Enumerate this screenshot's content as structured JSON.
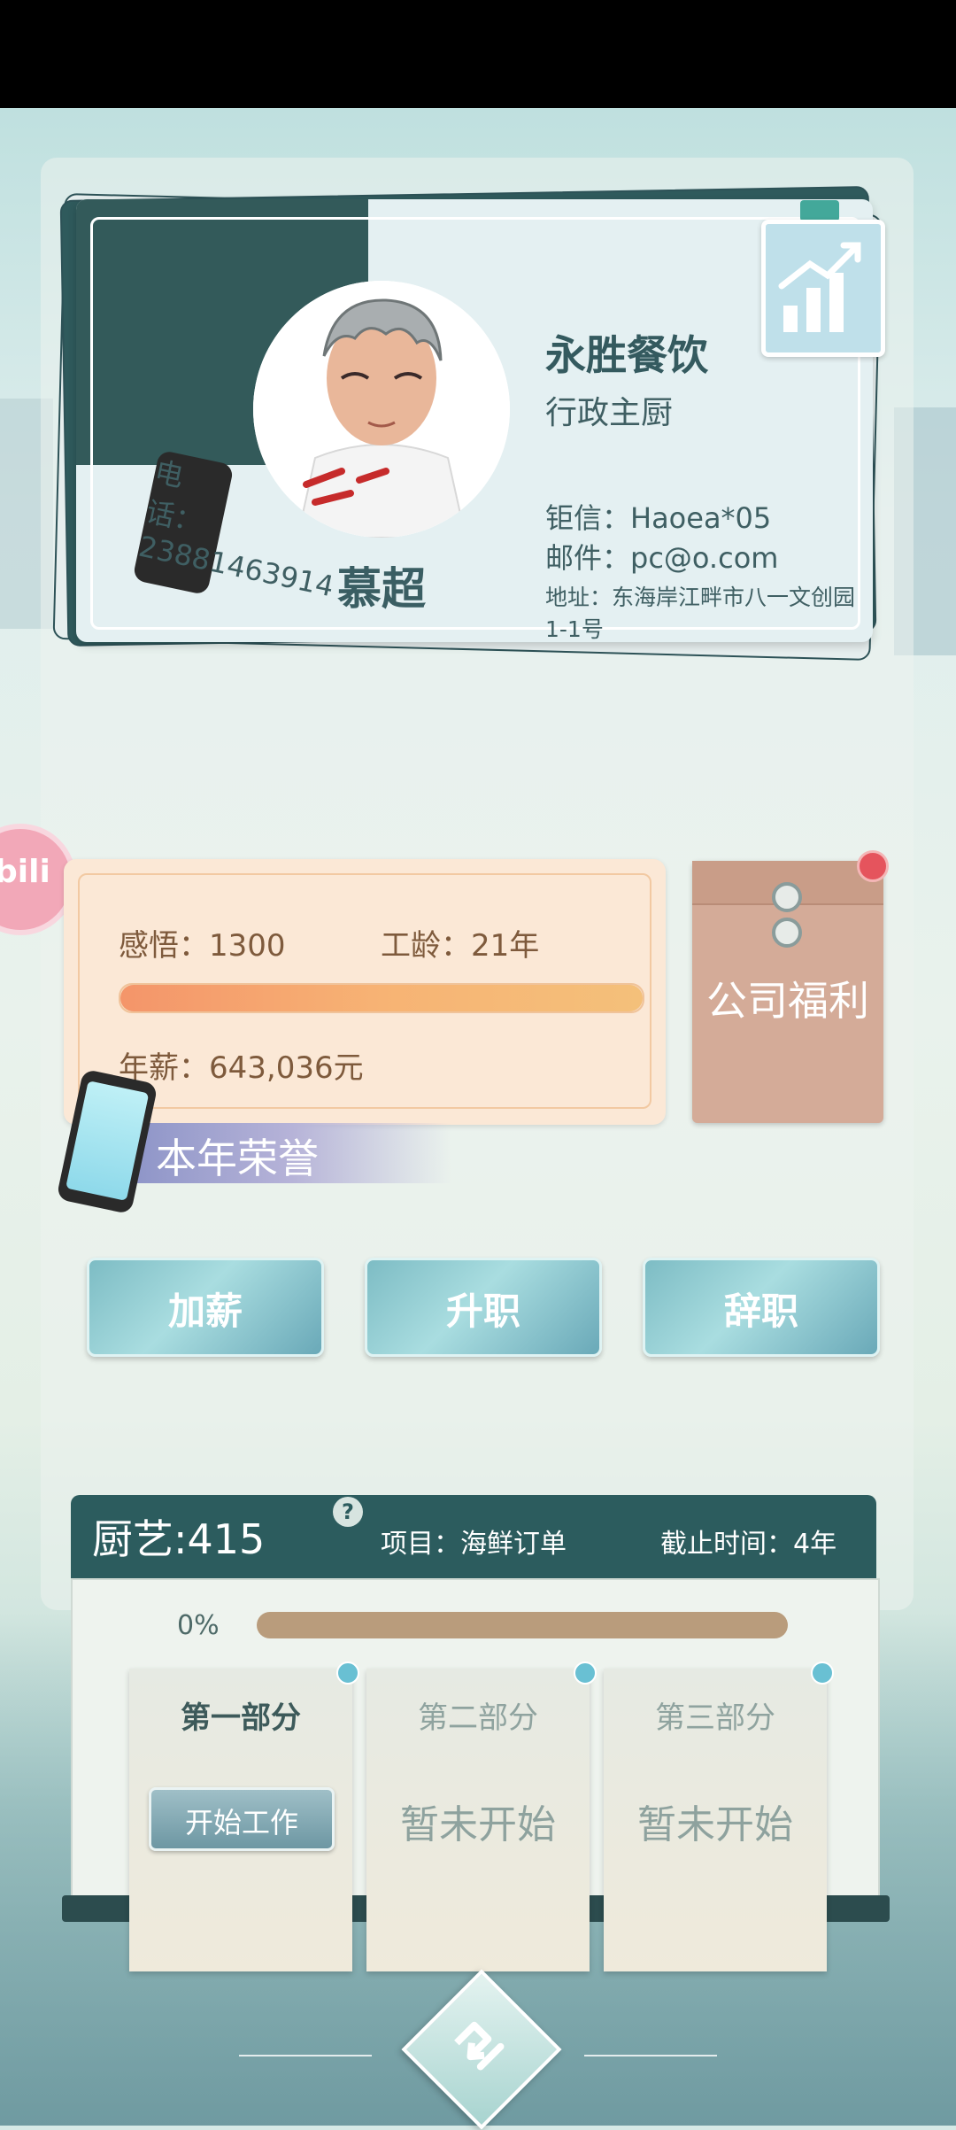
{
  "card": {
    "company": "永胜餐饮",
    "title": "行政主厨",
    "phone": "电话：23881463914",
    "wechat": "钜信：Haoea*05",
    "email": "邮件：pc@o.com",
    "address": "地址：东海岸江畔市八一文创园1-1号",
    "name": "慕超"
  },
  "stats": {
    "insight": "感悟：1300",
    "tenure": "工龄：21年",
    "salary": "年薪：643,036元",
    "bar_progress": 1.0
  },
  "welfare": {
    "label": "公司福利"
  },
  "honor": {
    "label": "本年荣誉"
  },
  "side_badge": {
    "label": "bili"
  },
  "actions": {
    "raise": "加薪",
    "promote": "升职",
    "resign": "辞职"
  },
  "project": {
    "skill": "厨艺:415",
    "help": "?",
    "name": "项目：海鲜订单",
    "deadline": "截止时间：4年",
    "progress_text": "0%",
    "progress": 0.0,
    "parts": [
      {
        "title": "第一部分",
        "button": "开始工作"
      },
      {
        "title": "第二部分",
        "status": "暂未开始"
      },
      {
        "title": "第三部分",
        "status": "暂未开始"
      }
    ]
  },
  "icons": {
    "chart": "growth-chart-icon",
    "back": "back-arrow-icon",
    "phone": "phone-icon"
  },
  "colors": {
    "teal_dark": "#2c5c5e",
    "salary_bar": "#f4956a",
    "envelope": "#d4ab98",
    "alert_dot": "#e5545d"
  }
}
